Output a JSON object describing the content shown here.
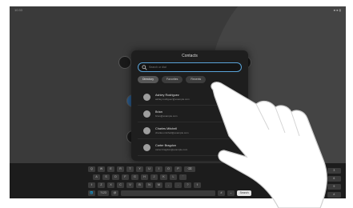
{
  "statusbar": {
    "left": "10:33",
    "right": "■ ■ ▮"
  },
  "dialog": {
    "title": "Contacts",
    "search": {
      "placeholder": "Search or dial",
      "value": ""
    },
    "tabs": [
      {
        "label": "Directory",
        "active": true
      },
      {
        "label": "Favorites",
        "active": false
      },
      {
        "label": "Recents",
        "active": false
      }
    ],
    "contacts": [
      {
        "name": "Ashley Rodriguez",
        "detail": "ashley.rodriguez@example.com"
      },
      {
        "name": "Brian",
        "detail": "brian@example.com"
      },
      {
        "name": "Charles Mitchell",
        "detail": "charles.mitchell@example.com"
      },
      {
        "name": "Carter Bragdon",
        "detail": "carter.bragdon@example.com"
      }
    ]
  },
  "keyboard": {
    "row1": [
      "Q",
      "W",
      "E",
      "R",
      "T",
      "Y",
      "U",
      "I",
      "O",
      "P",
      "⌫"
    ],
    "row2": [
      "A",
      "S",
      "D",
      "F",
      "G",
      "H",
      "J",
      "K",
      "L",
      "'"
    ],
    "row3": [
      "⇧",
      "Z",
      "X",
      "C",
      "V",
      "B",
      "N",
      "M",
      ",",
      ".",
      "?",
      "⇧"
    ],
    "row4": [
      "🌐",
      "?123",
      "@",
      "",
      "#",
      "⌄"
    ],
    "search_key": "Search",
    "numpad": [
      "1",
      "2",
      "3",
      "4",
      "5",
      "6",
      "7",
      "8",
      "9",
      "*",
      "0",
      "#"
    ]
  },
  "colors": {
    "accent": "#5aa3d8",
    "dialog_bg": "#1e1e1e",
    "screen_bg": "#3a3a3a"
  },
  "icons": [
    "search-icon",
    "hand-pointer-icon",
    "avatar-icon"
  ]
}
